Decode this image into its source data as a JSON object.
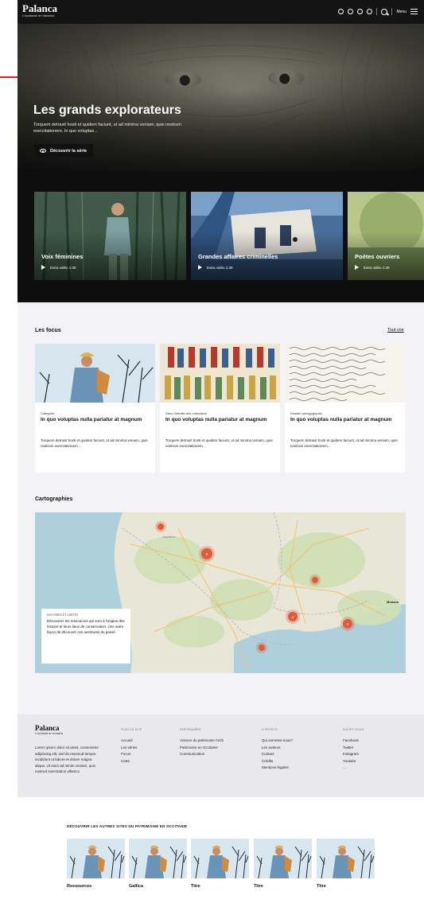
{
  "header": {
    "logo_name": "Palanca",
    "logo_tagline": "L'occitanie en histoires",
    "menu_label": "Menu"
  },
  "hero": {
    "title": "Les grands explorateurs",
    "description": "Torquem detraxit hosti et quidem faciunt, ut ad minima veniam, quis nostrum exercitationem. In quo voluptas...",
    "cta_label": "Découvrir la série"
  },
  "series": [
    {
      "title": "Voix féminines",
      "video": "Extra vidéo 1:30"
    },
    {
      "title": "Grandes affaires criminelles",
      "video": "Extra vidéo 1:30"
    },
    {
      "title": "Poètes ouvriers",
      "video": "Extra vidéo 1:30"
    }
  ],
  "focus": {
    "title": "Les focus",
    "see_all": "Tout voir",
    "cards": [
      {
        "category": "Catégorie",
        "title": "In quo voluptas nulla pariatur at magnum",
        "desc": "Torquem detraxit hosti et quidem faciunt, ut ad minima veniam, quis nostrum exercitationem..."
      },
      {
        "category": "Dans l'intimité des collections",
        "title": "In quo voluptas nulla pariatur at magnum",
        "desc": "Torquem detraxit hosti et quidem faciunt, ut ad minima veniam, quis nostrum exercitationem..."
      },
      {
        "category": "Dossier pédagogiques",
        "title": "In quo voluptas nulla pariatur at magnum",
        "desc": "Torquem detraxit hosti et quidem faciunt, ut ad minima veniam, quis nostrum exercitationem..."
      }
    ]
  },
  "map": {
    "title": "Cartographies",
    "note_kicker": "HISTOIRES ET CARTES",
    "note_text": "Découvrez les ressources qui sont à l'origine des histoire et leurs lieux de conservation. Une autre façon de découvrir ces aventures du passé.",
    "clusters": [
      {
        "label": ""
      },
      {
        "label": "6"
      },
      {
        "label": ""
      },
      {
        "label": "2"
      },
      {
        "label": "3"
      },
      {
        "label": ""
      }
    ],
    "city_labels": [
      "Aquitaine",
      "Monaco"
    ]
  },
  "footer": {
    "logo_name": "Palanca",
    "logo_tagline": "L'occitanie en histoires",
    "about": "Lorem ipsum dolor sit amet, consectetur adipiscing elit, sed do eiusmod tempor incididunt ut labore et dolore magna aliqua. Ut enim ad minim veniam, quis nostrud exercitation ullamco",
    "columns": [
      {
        "heading": "PLAN DU SITE",
        "items": [
          "Accueil",
          "Les séries",
          "Focus",
          "Carte"
        ]
      },
      {
        "heading": "PARTENAIRES",
        "items": [
          "Acteurs du patrimoine Archi",
          "Patrimoine en Occitanie",
          "Communication"
        ]
      },
      {
        "heading": "À PROPOS",
        "items": [
          "Qui sommes-nous?",
          "Les auteurs",
          "Contact",
          "Crédits",
          "Mentions légales"
        ]
      },
      {
        "heading": "SUIVEZ-NOUS",
        "items": [
          "Facebook",
          "Twitter",
          "Instagram",
          "Youtube",
          "..."
        ]
      }
    ]
  },
  "other_sites": {
    "title": "DÉCOUVRIR LES AUTRES SITES DU PATRIMOINE EN OCCITANIE",
    "sites": [
      {
        "label": "Ressources"
      },
      {
        "label": "Gallica"
      },
      {
        "label": "Titre"
      },
      {
        "label": "Titre"
      },
      {
        "label": "Titre"
      }
    ]
  },
  "colors": {
    "accent": "#e0241b",
    "marker": "#e25a3c",
    "dark": "#141414"
  }
}
